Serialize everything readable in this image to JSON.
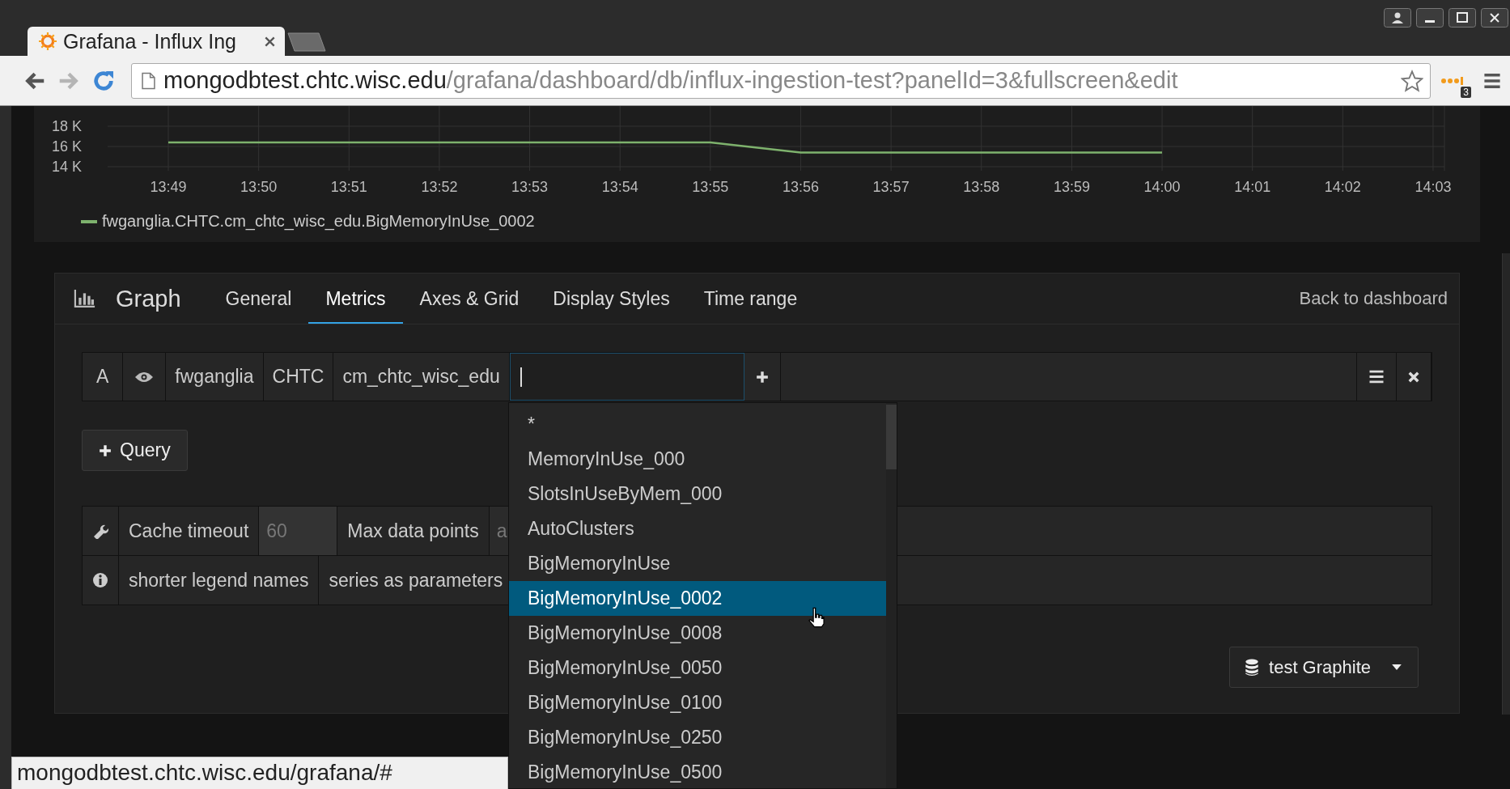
{
  "browser": {
    "tab_title": "Grafana - Influx Ing",
    "url_host": "mongodbtest.chtc.wisc.edu",
    "url_path": "/grafana/dashboard/db/influx-ingestion-test?panelId=3&fullscreen&edit",
    "forward_disabled": true,
    "extension_badge": "3",
    "status_url": "mongodbtest.chtc.wisc.edu/grafana/#"
  },
  "graph_panel": {
    "chart_data": {
      "type": "line",
      "categories": [
        "13:49",
        "13:50",
        "13:51",
        "13:52",
        "13:53",
        "13:54",
        "13:55",
        "13:56",
        "13:57",
        "13:58",
        "13:59",
        "14:00",
        "14:01",
        "14:02",
        "14:03"
      ],
      "series": [
        {
          "name": "fwganglia.CHTC.cm_chtc_wisc_edu.BigMemoryInUse_0002",
          "color": "#7eb26d",
          "values": [
            16.4,
            16.4,
            16.4,
            16.4,
            16.4,
            16.4,
            16.4,
            15.4,
            15.4,
            15.4,
            15.4,
            15.4,
            null,
            null,
            null
          ]
        }
      ],
      "ylim": [
        14,
        20
      ],
      "grid": true,
      "yticks": [
        {
          "value": 14,
          "label": "14 K"
        },
        {
          "value": 16,
          "label": "16 K"
        },
        {
          "value": 18,
          "label": "18 K"
        }
      ]
    }
  },
  "editor": {
    "title": "Graph",
    "tabs": [
      {
        "label": "General",
        "selected": false
      },
      {
        "label": "Metrics",
        "selected": true
      },
      {
        "label": "Axes & Grid",
        "selected": false
      },
      {
        "label": "Display Styles",
        "selected": false
      },
      {
        "label": "Time range",
        "selected": false
      }
    ],
    "back_link": "Back to dashboard",
    "query": {
      "ref": "A",
      "segments": [
        "fwganglia",
        "CHTC",
        "cm_chtc_wisc_edu"
      ]
    },
    "add_query_button": "Query",
    "options": [
      {
        "kind": "settings",
        "cells": [
          {
            "kind": "label",
            "text": "Cache timeout"
          },
          {
            "kind": "input",
            "placeholder": "60"
          },
          {
            "kind": "label",
            "text": "Max data points"
          },
          {
            "kind": "input",
            "placeholder": "a"
          }
        ]
      },
      {
        "kind": "info",
        "cells": [
          {
            "kind": "label",
            "text": "shorter legend names"
          },
          {
            "kind": "label",
            "text": "series as parameters"
          }
        ]
      }
    ],
    "datasource": "test Graphite"
  },
  "dropdown": {
    "items": [
      {
        "label": "*",
        "selected": false
      },
      {
        "label": "MemoryInUse_000",
        "selected": false
      },
      {
        "label": "SlotsInUseByMem_000",
        "selected": false
      },
      {
        "label": "AutoClusters",
        "selected": false
      },
      {
        "label": "BigMemoryInUse",
        "selected": false
      },
      {
        "label": "BigMemoryInUse_0002",
        "selected": true
      },
      {
        "label": "BigMemoryInUse_0008",
        "selected": false
      },
      {
        "label": "BigMemoryInUse_0050",
        "selected": false
      },
      {
        "label": "BigMemoryInUse_0100",
        "selected": false
      },
      {
        "label": "BigMemoryInUse_0250",
        "selected": false
      },
      {
        "label": "BigMemoryInUse_0500",
        "selected": false
      }
    ]
  }
}
